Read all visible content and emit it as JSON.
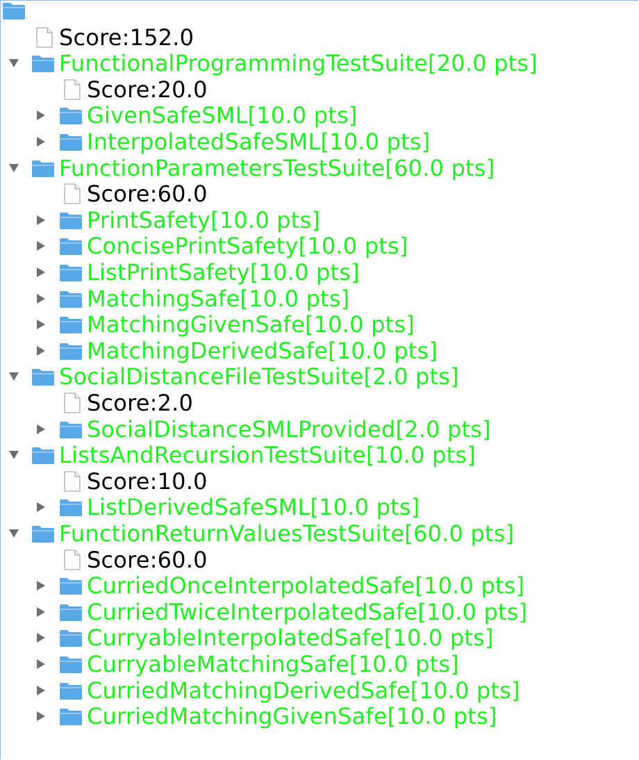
{
  "colors": {
    "label_green": "#22ee22",
    "folder_blue": "#5aa9e6",
    "score_text": "#000000"
  },
  "root": {
    "icon": "folder-icon"
  },
  "total_score": "Score:152.0",
  "suites": [
    {
      "label": "FunctionalProgrammingTestSuite[20.0 pts]",
      "expanded": true,
      "score": "Score:20.0",
      "tests": [
        "GivenSafeSML[10.0 pts]",
        "InterpolatedSafeSML[10.0 pts]"
      ]
    },
    {
      "label": "FunctionParametersTestSuite[60.0 pts]",
      "expanded": true,
      "score": "Score:60.0",
      "tests": [
        "PrintSafety[10.0 pts]",
        "ConcisePrintSafety[10.0 pts]",
        "ListPrintSafety[10.0 pts]",
        "MatchingSafe[10.0 pts]",
        "MatchingGivenSafe[10.0 pts]",
        "MatchingDerivedSafe[10.0 pts]"
      ]
    },
    {
      "label": "SocialDistanceFileTestSuite[2.0 pts]",
      "expanded": true,
      "score": "Score:2.0",
      "tests": [
        "SocialDistanceSMLProvided[2.0 pts]"
      ]
    },
    {
      "label": "ListsAndRecursionTestSuite[10.0 pts]",
      "expanded": true,
      "score": "Score:10.0",
      "tests": [
        "ListDerivedSafeSML[10.0 pts]"
      ]
    },
    {
      "label": "FunctionReturnValuesTestSuite[60.0 pts]",
      "expanded": true,
      "score": "Score:60.0",
      "tests": [
        "CurriedOnceInterpolatedSafe[10.0 pts]",
        "CurriedTwiceInterpolatedSafe[10.0 pts]",
        "CurryableInterpolatedSafe[10.0 pts]",
        "CurryableMatchingSafe[10.0 pts]",
        "CurriedMatchingDerivedSafe[10.0 pts]",
        "CurriedMatchingGivenSafe[10.0 pts]"
      ]
    }
  ]
}
